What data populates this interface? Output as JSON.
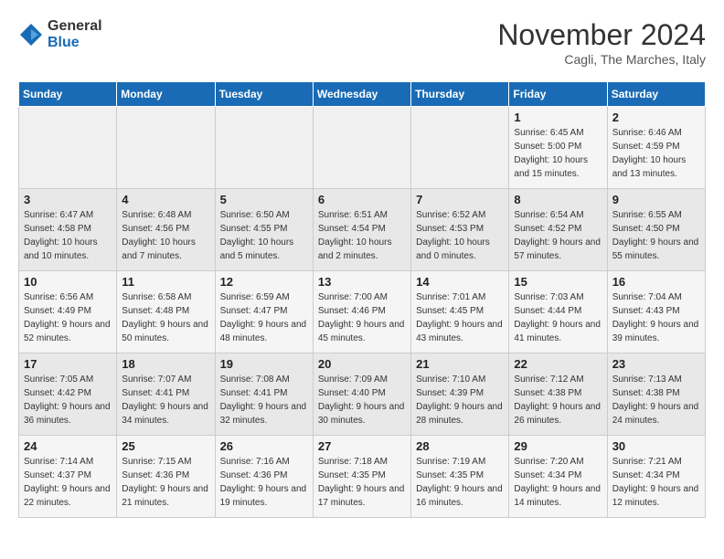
{
  "logo": {
    "general": "General",
    "blue": "Blue"
  },
  "title": "November 2024",
  "subtitle": "Cagli, The Marches, Italy",
  "days_of_week": [
    "Sunday",
    "Monday",
    "Tuesday",
    "Wednesday",
    "Thursday",
    "Friday",
    "Saturday"
  ],
  "weeks": [
    [
      {
        "day": "",
        "info": ""
      },
      {
        "day": "",
        "info": ""
      },
      {
        "day": "",
        "info": ""
      },
      {
        "day": "",
        "info": ""
      },
      {
        "day": "",
        "info": ""
      },
      {
        "day": "1",
        "info": "Sunrise: 6:45 AM\nSunset: 5:00 PM\nDaylight: 10 hours and 15 minutes."
      },
      {
        "day": "2",
        "info": "Sunrise: 6:46 AM\nSunset: 4:59 PM\nDaylight: 10 hours and 13 minutes."
      }
    ],
    [
      {
        "day": "3",
        "info": "Sunrise: 6:47 AM\nSunset: 4:58 PM\nDaylight: 10 hours and 10 minutes."
      },
      {
        "day": "4",
        "info": "Sunrise: 6:48 AM\nSunset: 4:56 PM\nDaylight: 10 hours and 7 minutes."
      },
      {
        "day": "5",
        "info": "Sunrise: 6:50 AM\nSunset: 4:55 PM\nDaylight: 10 hours and 5 minutes."
      },
      {
        "day": "6",
        "info": "Sunrise: 6:51 AM\nSunset: 4:54 PM\nDaylight: 10 hours and 2 minutes."
      },
      {
        "day": "7",
        "info": "Sunrise: 6:52 AM\nSunset: 4:53 PM\nDaylight: 10 hours and 0 minutes."
      },
      {
        "day": "8",
        "info": "Sunrise: 6:54 AM\nSunset: 4:52 PM\nDaylight: 9 hours and 57 minutes."
      },
      {
        "day": "9",
        "info": "Sunrise: 6:55 AM\nSunset: 4:50 PM\nDaylight: 9 hours and 55 minutes."
      }
    ],
    [
      {
        "day": "10",
        "info": "Sunrise: 6:56 AM\nSunset: 4:49 PM\nDaylight: 9 hours and 52 minutes."
      },
      {
        "day": "11",
        "info": "Sunrise: 6:58 AM\nSunset: 4:48 PM\nDaylight: 9 hours and 50 minutes."
      },
      {
        "day": "12",
        "info": "Sunrise: 6:59 AM\nSunset: 4:47 PM\nDaylight: 9 hours and 48 minutes."
      },
      {
        "day": "13",
        "info": "Sunrise: 7:00 AM\nSunset: 4:46 PM\nDaylight: 9 hours and 45 minutes."
      },
      {
        "day": "14",
        "info": "Sunrise: 7:01 AM\nSunset: 4:45 PM\nDaylight: 9 hours and 43 minutes."
      },
      {
        "day": "15",
        "info": "Sunrise: 7:03 AM\nSunset: 4:44 PM\nDaylight: 9 hours and 41 minutes."
      },
      {
        "day": "16",
        "info": "Sunrise: 7:04 AM\nSunset: 4:43 PM\nDaylight: 9 hours and 39 minutes."
      }
    ],
    [
      {
        "day": "17",
        "info": "Sunrise: 7:05 AM\nSunset: 4:42 PM\nDaylight: 9 hours and 36 minutes."
      },
      {
        "day": "18",
        "info": "Sunrise: 7:07 AM\nSunset: 4:41 PM\nDaylight: 9 hours and 34 minutes."
      },
      {
        "day": "19",
        "info": "Sunrise: 7:08 AM\nSunset: 4:41 PM\nDaylight: 9 hours and 32 minutes."
      },
      {
        "day": "20",
        "info": "Sunrise: 7:09 AM\nSunset: 4:40 PM\nDaylight: 9 hours and 30 minutes."
      },
      {
        "day": "21",
        "info": "Sunrise: 7:10 AM\nSunset: 4:39 PM\nDaylight: 9 hours and 28 minutes."
      },
      {
        "day": "22",
        "info": "Sunrise: 7:12 AM\nSunset: 4:38 PM\nDaylight: 9 hours and 26 minutes."
      },
      {
        "day": "23",
        "info": "Sunrise: 7:13 AM\nSunset: 4:38 PM\nDaylight: 9 hours and 24 minutes."
      }
    ],
    [
      {
        "day": "24",
        "info": "Sunrise: 7:14 AM\nSunset: 4:37 PM\nDaylight: 9 hours and 22 minutes."
      },
      {
        "day": "25",
        "info": "Sunrise: 7:15 AM\nSunset: 4:36 PM\nDaylight: 9 hours and 21 minutes."
      },
      {
        "day": "26",
        "info": "Sunrise: 7:16 AM\nSunset: 4:36 PM\nDaylight: 9 hours and 19 minutes."
      },
      {
        "day": "27",
        "info": "Sunrise: 7:18 AM\nSunset: 4:35 PM\nDaylight: 9 hours and 17 minutes."
      },
      {
        "day": "28",
        "info": "Sunrise: 7:19 AM\nSunset: 4:35 PM\nDaylight: 9 hours and 16 minutes."
      },
      {
        "day": "29",
        "info": "Sunrise: 7:20 AM\nSunset: 4:34 PM\nDaylight: 9 hours and 14 minutes."
      },
      {
        "day": "30",
        "info": "Sunrise: 7:21 AM\nSunset: 4:34 PM\nDaylight: 9 hours and 12 minutes."
      }
    ]
  ]
}
